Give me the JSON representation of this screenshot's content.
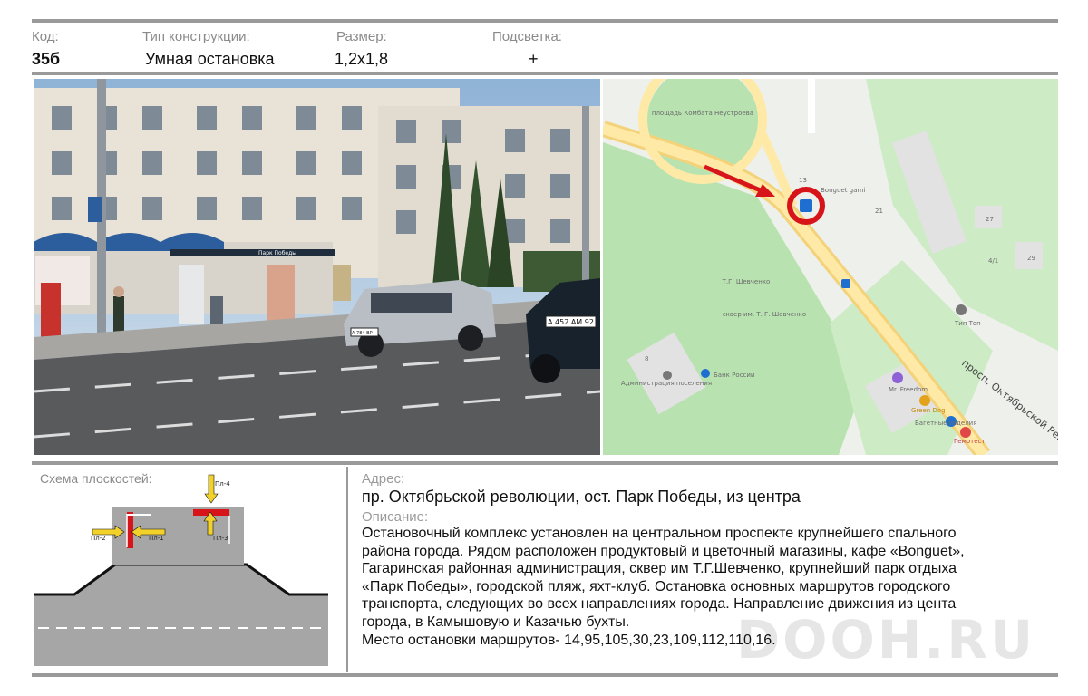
{
  "header": {
    "code_label": "Код:",
    "code_value": "35б",
    "type_label": "Тип конструкции:",
    "type_value": "Умная остановка",
    "size_label": "Размер:",
    "size_value": "1,2х1,8",
    "light_label": "Подсветка:",
    "light_value": "+"
  },
  "photo": {
    "stop_sign": "Парк Победы",
    "plate_right": "А 452 АМ 92",
    "plate_left": "А 784 ВР"
  },
  "map": {
    "labels": {
      "square": "площадь Комбата Неустроева",
      "shevchenko": "Т.Г. Шевченко",
      "park": "сквер им. Т. Г. Шевченко",
      "admin": "Администрация поселения",
      "bank": "Банк России",
      "freedom": "Mr. Freedom",
      "greendog": "Green Dog",
      "bagel": "Багетные изделия",
      "gemotest": "Гемотест",
      "tiptop": "Тип Топ",
      "street": "просп. Октябрьской Рев",
      "bonguet": "Bonguet garni",
      "n13": "13",
      "n21": "21",
      "n27": "27",
      "n29": "29",
      "n41": "4/1",
      "n8": "8"
    }
  },
  "scheme": {
    "title": "Схема плоскостей:",
    "pl1": "Пл-1",
    "pl2": "Пл-2",
    "pl3": "Пл-3",
    "pl4": "Пл-4"
  },
  "address": {
    "label": "Адрес:",
    "value": "пр. Октябрьской революции, ост. Парк Победы, из центра"
  },
  "description": {
    "label": "Описание:",
    "lines": [
      "Остановочный комплекс установлен на центральном проспекте крупнейшего спального",
      "района города. Рядом  расположен продуктовый и цветочный магазины, кафе «Bonguet»,",
      "Гагаринская районная администрация, сквер им Т.Г.Шевченко, крупнейший парк отдыха",
      "«Парк Победы», городской пляж, яхт-клуб. Остановка основных маршрутов городского",
      "транспорта, следующих во всех направлениях города. Направление движения из цента",
      "города, в  Камышовую и Казачью  бухты.",
      "Место остановки маршрутов- 14,95,105,30,23,109,112,110,16."
    ]
  },
  "watermark": "DOOH.RU"
}
